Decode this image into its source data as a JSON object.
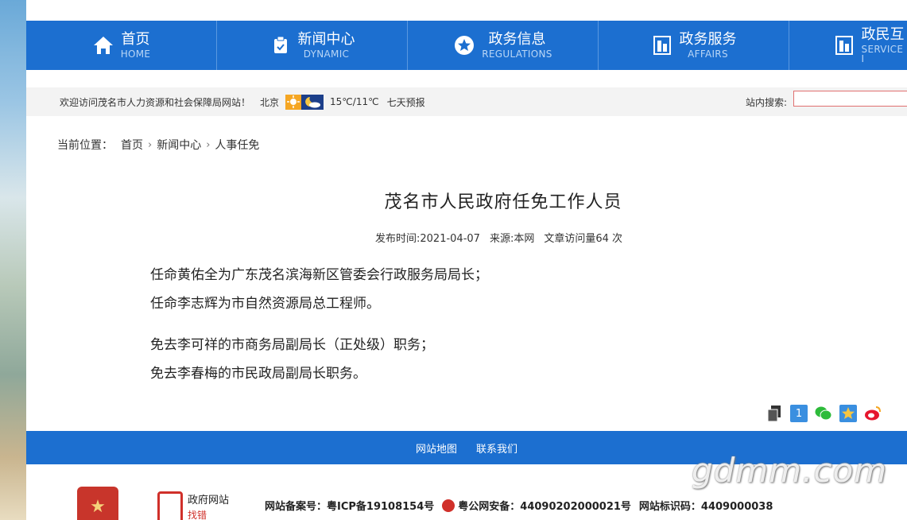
{
  "nav": [
    {
      "cn": "首页",
      "en": "HOME",
      "icon": "home-icon"
    },
    {
      "cn": "新闻中心",
      "en": "DYNAMIC",
      "icon": "clipboard-icon"
    },
    {
      "cn": "政务信息",
      "en": "REGULATIONS",
      "icon": "star-icon"
    },
    {
      "cn": "政务服务",
      "en": "AFFAIRS",
      "icon": "building-icon"
    },
    {
      "cn": "政民互",
      "en": "SERVICE I",
      "icon": "building-icon"
    }
  ],
  "infobar": {
    "welcome": "欢迎访问茂名市人力资源和社会保障局网站！",
    "city": "北京",
    "temp": "15℃/11℃",
    "forecast": "七天预报",
    "search_label": "站内搜索:",
    "search_value": ""
  },
  "breadcrumb": {
    "label": "当前位置：",
    "items": [
      "首页",
      "新闻中心",
      "人事任免"
    ]
  },
  "article": {
    "title": "茂名市人民政府任免工作人员",
    "date": "发布时间:2021-04-07",
    "source": "来源:本网",
    "views": "文章访问量64 次",
    "paragraphs": [
      "任命黄佑全为广东茂名滨海新区管委会行政服务局局长；",
      "任命李志辉为市自然资源局总工程师。",
      "免去李可祥的市商务局副局长（正处级）职务；",
      "免去李春梅的市民政局副局长职务。"
    ]
  },
  "share": [
    "print-icon",
    "baidu-icon",
    "wechat-icon",
    "qzone-icon",
    "weibo-icon"
  ],
  "footer": {
    "links": [
      "网站地图",
      "联系我们"
    ],
    "gov_site": "政府网站",
    "gov_err": "找错",
    "icp": "网站备案号：粤ICP备19108154号",
    "police": "粤公网安备：44090202000021号",
    "site_id": "网站标识码：4409000038"
  },
  "watermark": "gdmm.com",
  "colors": {
    "nav_blue": "#1c6fd0",
    "search_border": "#e07070"
  }
}
